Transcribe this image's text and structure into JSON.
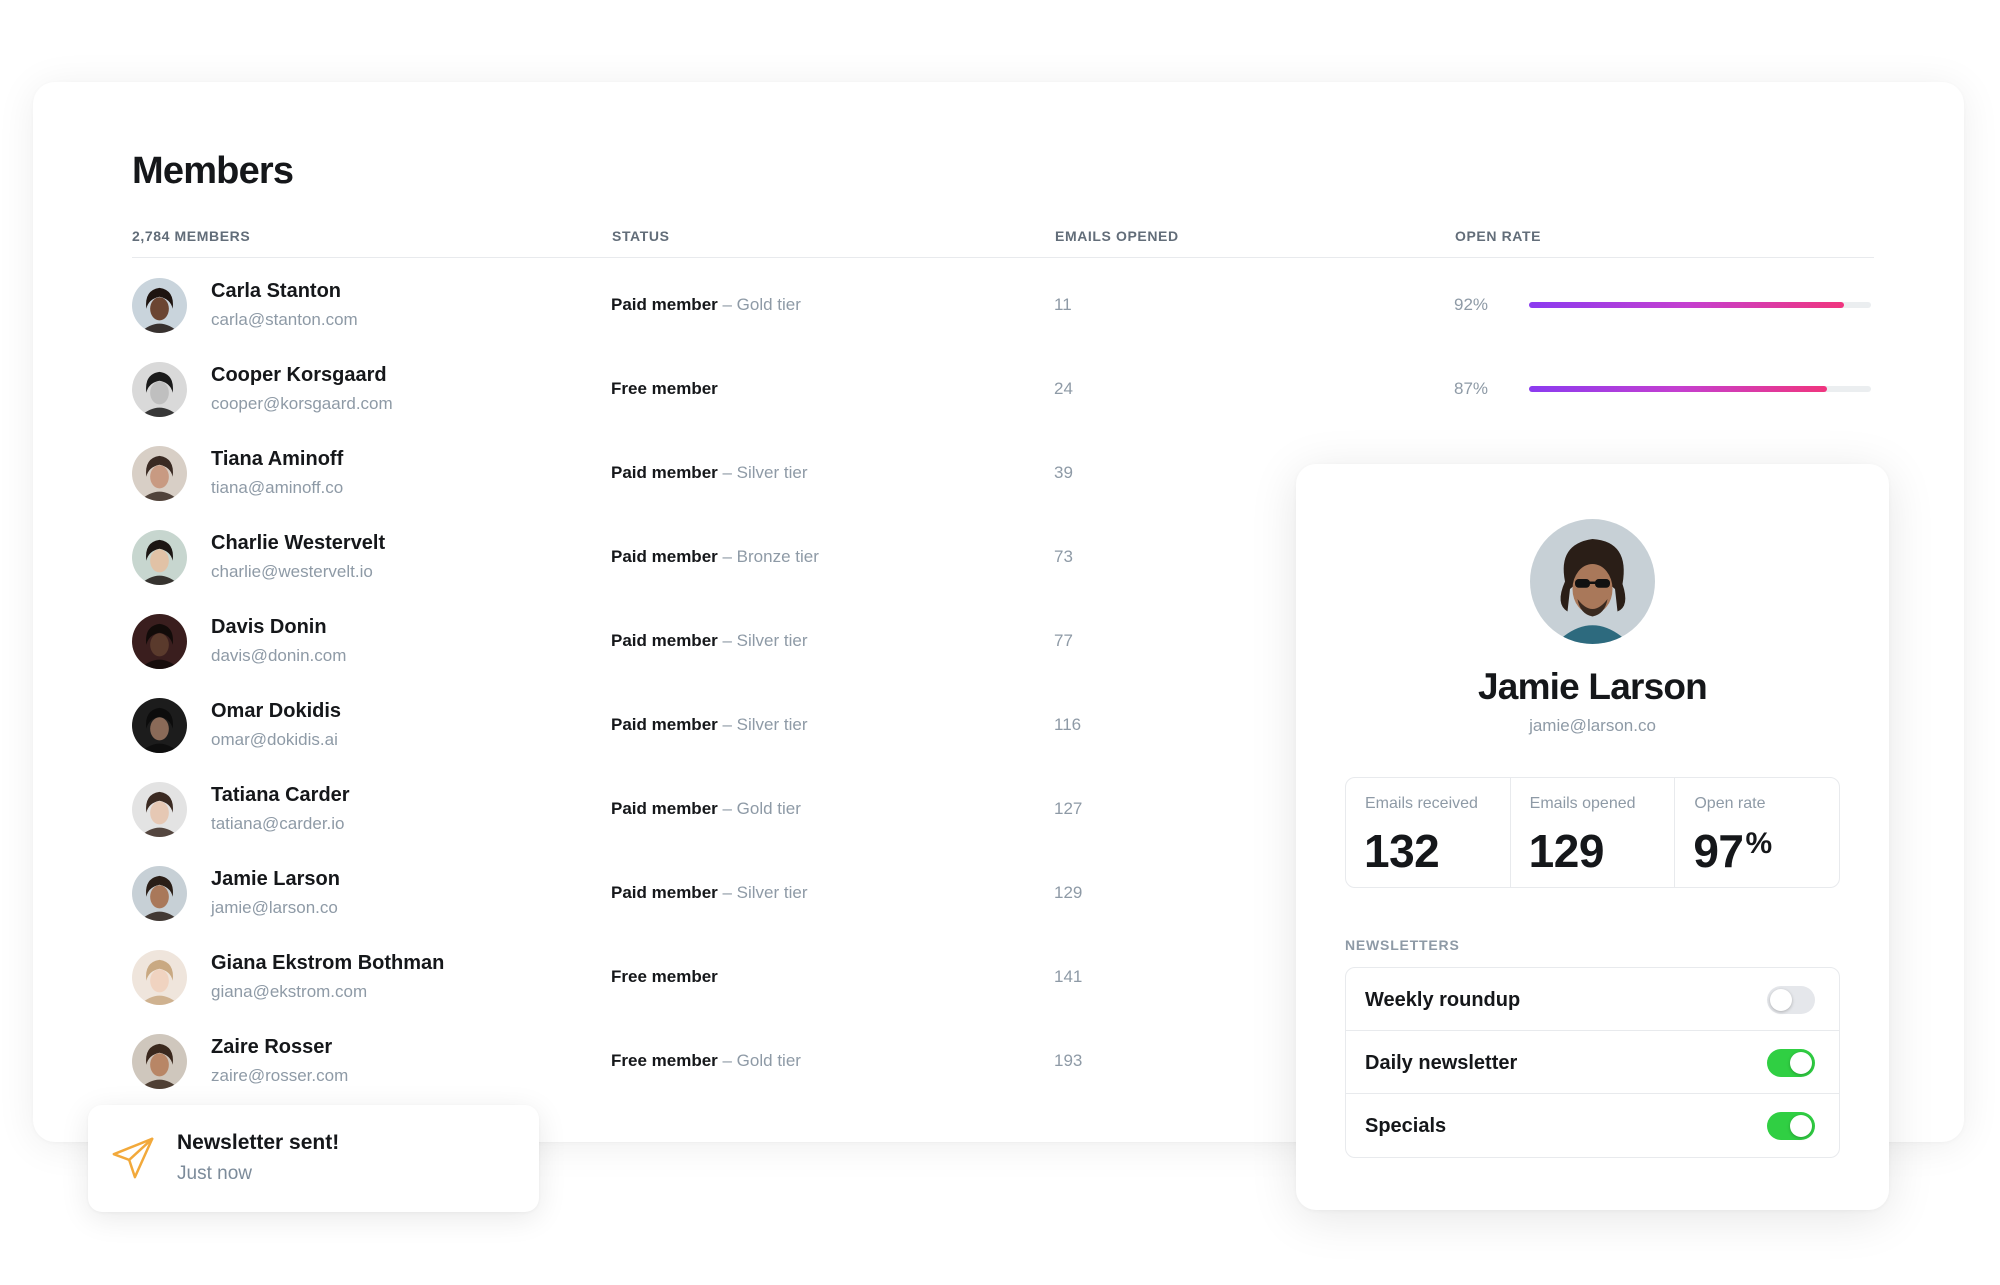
{
  "page_title": "Members",
  "table": {
    "columns": {
      "members": "2,784 MEMBERS",
      "status": "STATUS",
      "emails_opened": "EMAILS OPENED",
      "open_rate": "OPEN RATE"
    },
    "rows": [
      {
        "name": "Carla Stanton",
        "email": "carla@stanton.com",
        "status_type": "Paid member",
        "status_tier": " – Gold tier",
        "emails_opened": "11",
        "open_rate": "92%",
        "open_rate_value": 0.92
      },
      {
        "name": "Cooper Korsgaard",
        "email": "cooper@korsgaard.com",
        "status_type": "Free member",
        "status_tier": "",
        "emails_opened": "24",
        "open_rate": "87%",
        "open_rate_value": 0.87
      },
      {
        "name": "Tiana Aminoff",
        "email": "tiana@aminoff.co",
        "status_type": "Paid member",
        "status_tier": " – Silver tier",
        "emails_opened": "39"
      },
      {
        "name": "Charlie Westervelt",
        "email": "charlie@westervelt.io",
        "status_type": "Paid member",
        "status_tier": " – Bronze tier",
        "emails_opened": "73"
      },
      {
        "name": "Davis Donin",
        "email": "davis@donin.com",
        "status_type": "Paid member",
        "status_tier": " – Silver tier",
        "emails_opened": "77"
      },
      {
        "name": "Omar Dokidis",
        "email": "omar@dokidis.ai",
        "status_type": "Paid member",
        "status_tier": " – Silver tier",
        "emails_opened": "116"
      },
      {
        "name": "Tatiana Carder",
        "email": "tatiana@carder.io",
        "status_type": "Paid member",
        "status_tier": " – Gold tier",
        "emails_opened": "127"
      },
      {
        "name": "Jamie Larson",
        "email": "jamie@larson.co",
        "status_type": "Paid member",
        "status_tier": " – Silver tier",
        "emails_opened": "129"
      },
      {
        "name": "Giana Ekstrom Bothman",
        "email": "giana@ekstrom.com",
        "status_type": "Free member",
        "status_tier": "",
        "emails_opened": "141"
      },
      {
        "name": "Zaire Rosser",
        "email": "zaire@rosser.com",
        "status_type": "Free member",
        "status_tier": " – Gold tier",
        "emails_opened": "193"
      }
    ]
  },
  "toast": {
    "title": "Newsletter sent!",
    "subtitle": "Just now",
    "icon": "paper-plane-icon"
  },
  "detail": {
    "name": "Jamie Larson",
    "email": "jamie@larson.co",
    "stats": [
      {
        "label": "Emails received",
        "value": "132",
        "suffix": ""
      },
      {
        "label": "Emails opened",
        "value": "129",
        "suffix": ""
      },
      {
        "label": "Open rate",
        "value": "97",
        "suffix": "%"
      }
    ],
    "newsletters_heading": "NEWSLETTERS",
    "newsletters": [
      {
        "label": "Weekly roundup",
        "enabled": false
      },
      {
        "label": "Daily newsletter",
        "enabled": true
      },
      {
        "label": "Specials",
        "enabled": true
      }
    ]
  },
  "colors": {
    "toggle_on": "#30cf43",
    "toggle_off": "#e5e7eb",
    "bar_gradient_start": "#8b3bf0",
    "bar_gradient_end": "#f0357e",
    "toast_icon": "#f2a93b"
  }
}
